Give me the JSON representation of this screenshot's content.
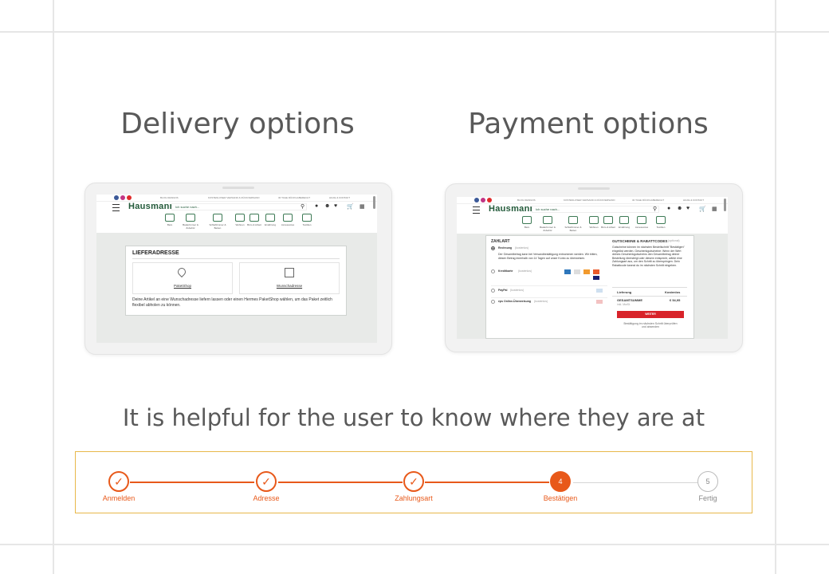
{
  "headings": {
    "delivery": "Delivery options",
    "payment": "Payment options",
    "caption": "It is helpful for the user to know where they are at"
  },
  "shop": {
    "logo": "Hausmann",
    "search_placeholder": "Ich suche nach...",
    "topbar_links": [
      "BLOG DESIGNS",
      "KOSTENLOSER VERSAND & RÜCKVERSAND",
      "30 TAGE RÜCKGABERECHT",
      "HILFE & KONTAKT"
    ],
    "categories": [
      "Bars",
      "Badezimmer & Zubehör",
      "Schlafzimmer & Betten",
      "Wohnen",
      "Büro & Arbeit",
      "Ernährung",
      "Accessoires",
      "Textilien"
    ]
  },
  "delivery_screen": {
    "section_title": "LIEFERADRESSE",
    "option_paketshop": "PaketShop",
    "option_wunschadresse": "Wunschadresse",
    "info_text": "Deine Artikel an eine Wunschadresse liefern lassen oder einen Hermes PaketShop wählen, um das Paket zeitlich flexibel abholen zu können."
  },
  "payment_screen": {
    "zahlart_title": "ZAHLART",
    "methods": [
      {
        "label": "Rechnung",
        "note": "(kostenlos)",
        "detail": "Der Gesamtbetrag kann bei Versandbestätigung entnommen werden. Wir bitten, diesen Betrag innerhalb von 14 Tagen auf unser Konto zu überweisen."
      },
      {
        "label": "Kreditkarte",
        "note": "(kostenlos)"
      },
      {
        "label": "PayPal",
        "note": "(kostenlos)"
      },
      {
        "label": "eps Online-Überweisung",
        "note": "(kostenlos)"
      }
    ],
    "voucher_title": "GUTSCHEINE & RABATTCODES",
    "voucher_note": "(optional)",
    "voucher_text": "Gutscheine können im nächsten Bestellschritt \"Bestätigen\" eingelöst werden. Geschenkgutscheine: Wenn der Wert deines Geschenkgutscheins den Gesamtbetrag deiner Bestellung übersteigt oder diesem entspricht, wähle eine Zahlungsart aus, um den Schritt zu überspringen. Dein Rabattcode kannst du im nächsten Schritt eingeben.",
    "delivery_label": "Lieferung",
    "delivery_value": "Kostenlos",
    "total_label": "GESAMTSUMME",
    "total_note": "inkl. MwSt.",
    "total_value": "€ 54,95",
    "next_button": "WEITER",
    "footer_note": "Bestätigung im nächsten Schritt überprüfen und absenden"
  },
  "stepper": {
    "steps": [
      {
        "label": "Anmelden",
        "state": "done"
      },
      {
        "label": "Adresse",
        "state": "done"
      },
      {
        "label": "Zahlungsart",
        "state": "done"
      },
      {
        "label": "Bestätigen",
        "state": "current",
        "number": "4"
      },
      {
        "label": "Fertig",
        "state": "upcoming",
        "number": "5"
      }
    ]
  },
  "colors": {
    "accent": "#e8591a",
    "brand_green": "#235a3a",
    "border_gold": "#e8b84a",
    "heading_text": "#595959"
  }
}
